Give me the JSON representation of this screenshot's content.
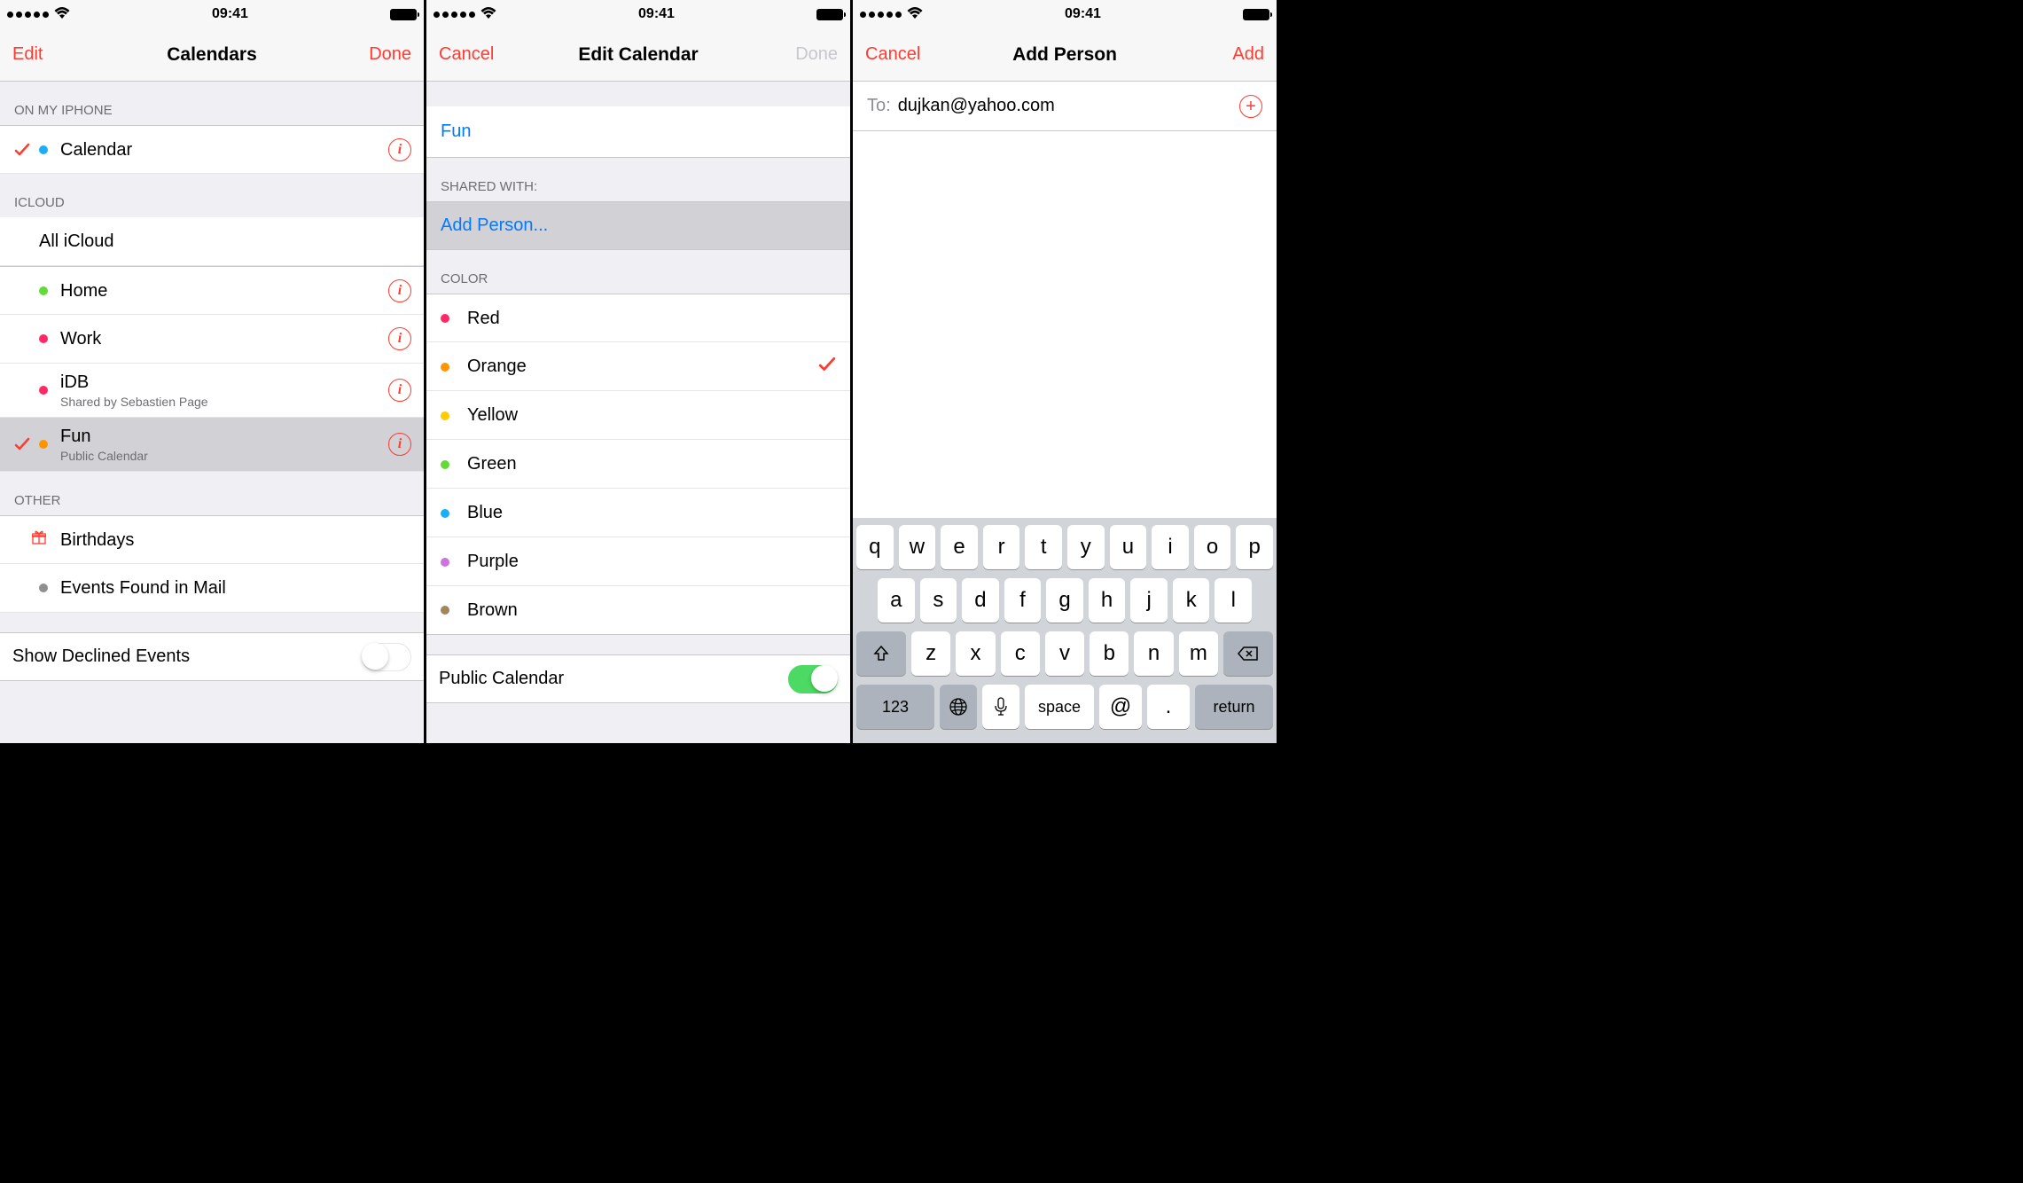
{
  "status": {
    "time": "09:41"
  },
  "screen1": {
    "nav": {
      "left": "Edit",
      "title": "Calendars",
      "right": "Done"
    },
    "sections": {
      "onmyiphone": "On My iPhone",
      "icloud": "iCloud",
      "other": "Other"
    },
    "onmyiphone": [
      {
        "label": "Calendar",
        "color": "#1badf8",
        "checked": true
      }
    ],
    "icloud_all": "All iCloud",
    "icloud": [
      {
        "label": "Home",
        "color": "#63da38",
        "checked": false
      },
      {
        "label": "Work",
        "color": "#ff2968",
        "checked": false
      },
      {
        "label": "iDB",
        "sub": "Shared by Sebastien Page",
        "color": "#ff2968",
        "checked": false
      },
      {
        "label": "Fun",
        "sub": "Public Calendar",
        "color": "#ff9500",
        "checked": true,
        "highlighted": true
      }
    ],
    "other": [
      {
        "label": "Birthdays",
        "icon": "gift"
      },
      {
        "label": "Events Found in Mail",
        "color": "#8e8e93"
      }
    ],
    "show_declined": "Show Declined Events"
  },
  "screen2": {
    "nav": {
      "left": "Cancel",
      "title": "Edit Calendar",
      "right": "Done"
    },
    "name": "Fun",
    "shared_with": "Shared With:",
    "add_person": "Add Person...",
    "color_header": "Color",
    "colors": [
      {
        "label": "Red",
        "color": "#ff2968",
        "checked": false
      },
      {
        "label": "Orange",
        "color": "#ff9500",
        "checked": true
      },
      {
        "label": "Yellow",
        "color": "#ffcc00",
        "checked": false
      },
      {
        "label": "Green",
        "color": "#63da38",
        "checked": false
      },
      {
        "label": "Blue",
        "color": "#1badf8",
        "checked": false
      },
      {
        "label": "Purple",
        "color": "#cc73e1",
        "checked": false
      },
      {
        "label": "Brown",
        "color": "#a2845e",
        "checked": false
      }
    ],
    "public_calendar": "Public Calendar"
  },
  "screen3": {
    "nav": {
      "left": "Cancel",
      "title": "Add Person",
      "right": "Add"
    },
    "to_label": "To:",
    "to_value": "dujkan@yahoo.com",
    "keyboard": {
      "row1": [
        "q",
        "w",
        "e",
        "r",
        "t",
        "y",
        "u",
        "i",
        "o",
        "p"
      ],
      "row2": [
        "a",
        "s",
        "d",
        "f",
        "g",
        "h",
        "j",
        "k",
        "l"
      ],
      "row3": [
        "z",
        "x",
        "c",
        "v",
        "b",
        "n",
        "m"
      ],
      "num": "123",
      "space": "space",
      "at": "@",
      "dot": ".",
      "return": "return"
    }
  }
}
